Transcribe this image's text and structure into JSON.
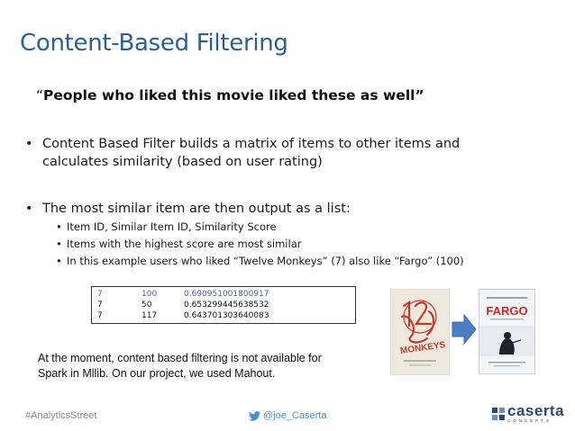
{
  "slide": {
    "title": "Content-Based Filtering",
    "quote_open": "“",
    "quote_text": "People who liked this movie liked these as well”",
    "bullets": [
      {
        "text": "Content Based Filter builds a matrix of items to other items and calculates similarity (based on user rating)"
      },
      {
        "text": "The most similar item are then output as a list:"
      }
    ],
    "sub_bullets": [
      "Item ID, Similar Item ID, Similarity Score",
      "Items with the highest score are most similar",
      "In this example users who liked “Twelve Monkeys” (7)  also like “Fargo” (100)"
    ],
    "table_rows": [
      [
        "7",
        "100",
        "0.690951001800917"
      ],
      [
        "7",
        "50",
        "0.653299445638532"
      ],
      [
        "7",
        "117",
        "0.643701303640083"
      ]
    ],
    "note": "At the moment, content based filtering is not available for Spark in Mllib.  On our project, we used Mahout."
  },
  "posters": {
    "left_title": "12 MONKEYS",
    "right_title": "FARGO"
  },
  "footer": {
    "hashtag": "#AnalyticsStreet",
    "twitter": "@joe_Caserta",
    "twitter_icon": "twitter-bird-icon",
    "logo_text": "caserta",
    "logo_sub": "CONCEPTS"
  },
  "colors": {
    "title": "#2e5f93",
    "arrow": "#4a7fc1",
    "twitter": "#4a8fd1"
  }
}
